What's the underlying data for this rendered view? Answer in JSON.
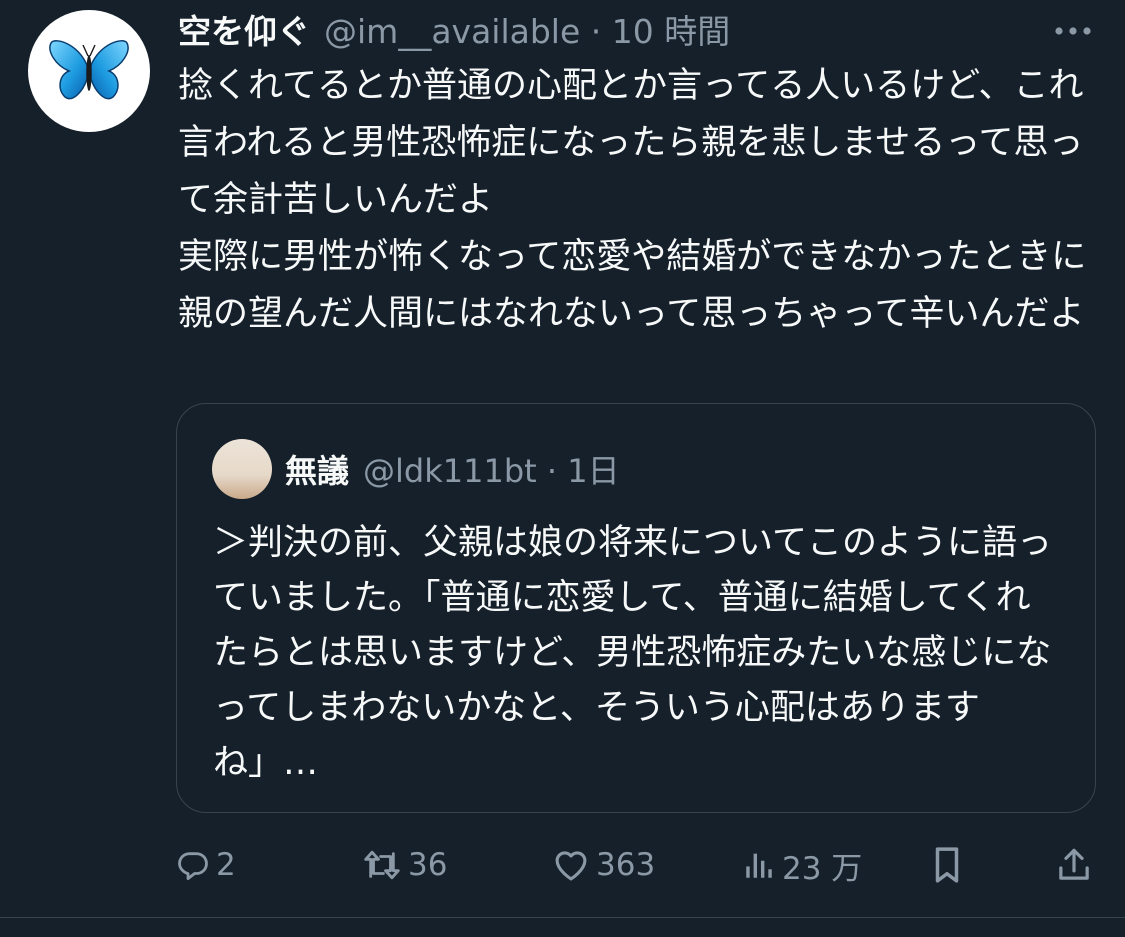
{
  "tweet": {
    "display_name": "空を仰ぐ",
    "meta": "@im__available · 10 時間",
    "text": "捻くれてるとか普通の心配とか言ってる人いるけど、これ言われると男性恐怖症になったら親を悲しませるって思って余計苦しいんだよ\n実際に男性が怖くなって恋愛や結婚ができなかったときに親の望んだ人間にはなれないって思っちゃって辛いんだよ",
    "avatar_icon": "butterfly-icon"
  },
  "quote": {
    "display_name": "無議",
    "meta": "@ldk111bt · 1日",
    "text": "＞判決の前、父親は娘の将来についてこのように語っていました。「普通に恋愛して、普通に結婚してくれたらとは思いますけど、男性恐怖症みたいな感じになってしまわないかなと、そういう心配はありますね」…"
  },
  "actions": {
    "reply_count": "2",
    "retweet_count": "36",
    "like_count": "363",
    "views_count": "23 万"
  },
  "colors": {
    "background": "#15202b",
    "text_primary": "#f7f9f9",
    "text_secondary": "#8b98a5",
    "border": "#38444d",
    "butterfly_blue": "#2aa7e8"
  }
}
